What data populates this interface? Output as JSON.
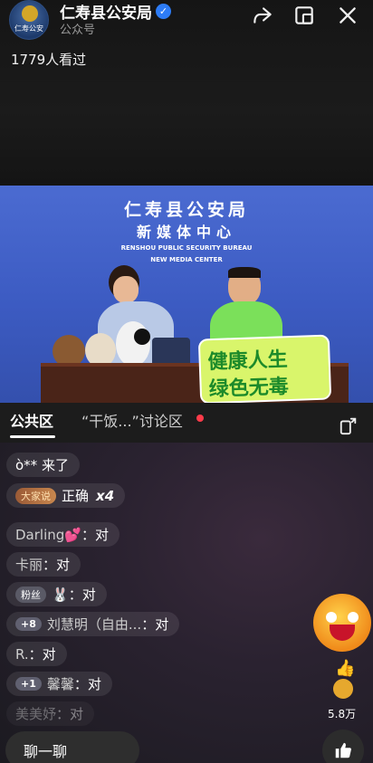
{
  "header": {
    "avatar_text": "仁寿公安",
    "account_name": "仁寿县公安局",
    "account_type": "公众号",
    "views": "1779人看过"
  },
  "video": {
    "title": "仁寿县公安局",
    "subtitle": "新媒体中心",
    "en_line1": "RENSHOU PUBLIC SECURITY BUREAU",
    "en_line2": "NEW MEDIA CENTER",
    "sign_line1": "健康人生",
    "sign_line2": "绿色无毒"
  },
  "tabs": {
    "public": "公共区",
    "discussion": "“干饭...”讨论区"
  },
  "messages": [
    {
      "name": "ò** 来了",
      "text": ""
    },
    {
      "badge": "大家说",
      "text": "正确",
      "multiplier": "x4"
    },
    {
      "name": "Darling💕",
      "text": "：对"
    },
    {
      "name": "卡丽",
      "text": "：对"
    },
    {
      "badge": "粉丝",
      "name": "🐰",
      "text": "：对"
    },
    {
      "badge": "+8",
      "name": "刘慧明（自由...",
      "text": "：对"
    },
    {
      "name": "R.",
      "text": "：对"
    },
    {
      "badge": "+1",
      "name": "馨馨",
      "text": "：对"
    },
    {
      "name": "美美妤",
      "text": "：对"
    }
  ],
  "bottom": {
    "input_placeholder": "聊一聊",
    "like_count": "5.8万"
  }
}
